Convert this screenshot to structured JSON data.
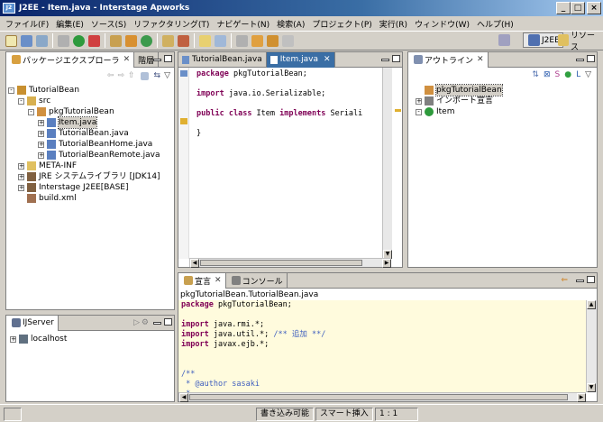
{
  "window": {
    "title": "J2EE - Item.java - Interstage Apworks",
    "icon_text": "J2"
  },
  "window_controls": {
    "minimize": "_",
    "maximize": "□",
    "close": "×"
  },
  "menu": [
    "ファイル(F)",
    "編集(E)",
    "ソース(S)",
    "リファクタリング(T)",
    "ナビゲート(N)",
    "検索(A)",
    "プロジェクト(P)",
    "実行(R)",
    "ウィンドウ(W)",
    "ヘルプ(H)"
  ],
  "perspectives": {
    "j2ee": "J2EE",
    "resource": "リソース"
  },
  "left_top": {
    "tabs": [
      "パッケージエクスプローラ",
      "階層"
    ],
    "tree": [
      {
        "label": "TutorialBean",
        "icon": "project-icon",
        "depth": 0,
        "exp": "-"
      },
      {
        "label": "src",
        "icon": "source-folder-icon",
        "depth": 1,
        "exp": "-"
      },
      {
        "label": "pkgTutorialBean",
        "icon": "package-icon",
        "depth": 2,
        "exp": "-"
      },
      {
        "label": "Item.java",
        "icon": "java-file-icon",
        "depth": 3,
        "exp": "+",
        "selected": true
      },
      {
        "label": "TutorialBean.java",
        "icon": "java-file-icon",
        "depth": 3,
        "exp": "+"
      },
      {
        "label": "TutorialBeanHome.java",
        "icon": "java-file-icon",
        "depth": 3,
        "exp": "+"
      },
      {
        "label": "TutorialBeanRemote.java",
        "icon": "java-file-icon",
        "depth": 3,
        "exp": "+"
      },
      {
        "label": "META-INF",
        "icon": "folder-icon",
        "depth": 1,
        "exp": "+"
      },
      {
        "label": "JRE システムライブラリ [JDK14]",
        "icon": "library-icon",
        "depth": 1,
        "exp": "+"
      },
      {
        "label": "Interstage J2EE[BASE]",
        "icon": "library-icon",
        "depth": 1,
        "exp": "+"
      },
      {
        "label": "build.xml",
        "icon": "xml-file-icon",
        "depth": 1,
        "exp": ""
      }
    ]
  },
  "left_bottom": {
    "tab": "IJServer",
    "tree": [
      {
        "label": "localhost",
        "icon": "server-icon",
        "exp": "+"
      }
    ]
  },
  "editor": {
    "tabs": [
      "TutorialBean.java",
      "Item.java"
    ],
    "lines": [
      [
        {
          "t": "package",
          "c": "kw"
        },
        {
          "t": " pkgTutorialBean;",
          "c": ""
        }
      ],
      [],
      [
        {
          "t": "import",
          "c": "kw"
        },
        {
          "t": " java.io.Serializable;",
          "c": ""
        }
      ],
      [],
      [
        {
          "t": "public",
          "c": "kw"
        },
        {
          "t": " ",
          "c": ""
        },
        {
          "t": "class",
          "c": "kw"
        },
        {
          "t": " Item ",
          "c": ""
        },
        {
          "t": "implements",
          "c": "kw"
        },
        {
          "t": " Seriali",
          "c": ""
        }
      ],
      [],
      [
        {
          "t": "}",
          "c": ""
        }
      ]
    ]
  },
  "outline": {
    "tab": "アウトライン",
    "tree": [
      {
        "label": "pkgTutorialBean",
        "icon": "package-icon",
        "depth": 0,
        "exp": "",
        "selected": true
      },
      {
        "label": "インポート宣言",
        "icon": "import-icon",
        "depth": 0,
        "exp": "+"
      },
      {
        "label": "Item",
        "icon": "class-icon",
        "depth": 0,
        "exp": "-"
      }
    ]
  },
  "bottom": {
    "tabs": [
      "宣言",
      "コンソール"
    ],
    "path": "pkgTutorialBean.TutorialBean.java",
    "lines": [
      [
        {
          "t": "package",
          "c": "kw"
        },
        {
          "t": " pkgTutorialBean;",
          "c": ""
        }
      ],
      [],
      [
        {
          "t": "import",
          "c": "kw"
        },
        {
          "t": " java.rmi.*;",
          "c": ""
        }
      ],
      [
        {
          "t": "import",
          "c": "kw"
        },
        {
          "t": " java.util.*; ",
          "c": ""
        },
        {
          "t": "/** 追加 **/",
          "c": "cm"
        }
      ],
      [
        {
          "t": "import",
          "c": "kw"
        },
        {
          "t": " javax.ejb.*;",
          "c": ""
        }
      ],
      [],
      [],
      [
        {
          "t": "/**",
          "c": "cm"
        }
      ],
      [
        {
          "t": " * @author sasaki",
          "c": "cm"
        }
      ],
      [
        {
          "t": " *",
          "c": "cm"
        }
      ]
    ]
  },
  "status": {
    "writable": "書き込み可能",
    "insert": "スマート挿入",
    "position": "1 : 1"
  }
}
